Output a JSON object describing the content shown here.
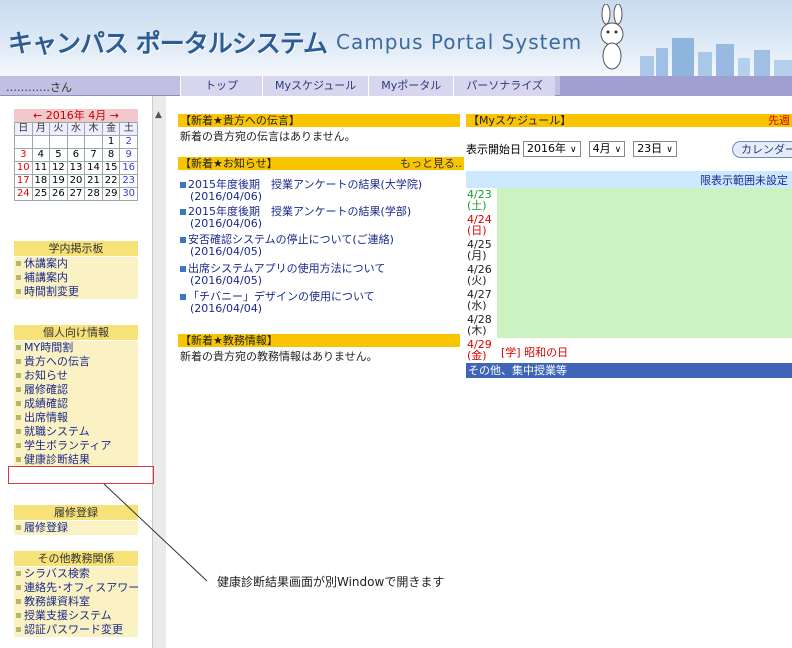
{
  "header": {
    "title_jp": "キャンパス ポータルシステム",
    "title_en": "Campus Portal System"
  },
  "user": {
    "name": "…………さん"
  },
  "nav": {
    "tabs": [
      "トップ",
      "Myスケジュール",
      "Myポータル",
      "パーソナライズ"
    ]
  },
  "calendar": {
    "prev": "←",
    "title": "2016年 4月",
    "next": "→",
    "weekdays": [
      "日",
      "月",
      "火",
      "水",
      "木",
      "金",
      "土"
    ],
    "weeks": [
      [
        "",
        "",
        "",
        "",
        "",
        "1",
        "2"
      ],
      [
        "3",
        "4",
        "5",
        "6",
        "7",
        "8",
        "9"
      ],
      [
        "10",
        "11",
        "12",
        "13",
        "14",
        "15",
        "16"
      ],
      [
        "17",
        "18",
        "19",
        "20",
        "21",
        "22",
        "23"
      ],
      [
        "24",
        "25",
        "26",
        "27",
        "28",
        "29",
        "30"
      ]
    ]
  },
  "sidebar": {
    "board": {
      "heading": "学内掲示板",
      "items": [
        "休講案内",
        "補講案内",
        "時間割変更"
      ]
    },
    "personal": {
      "heading": "個人向け情報",
      "items": [
        "MY時間割",
        "貴方への伝言",
        "お知らせ",
        "履修確認",
        "成績確認",
        "出席情報",
        "就職システム",
        "学生ボランティア",
        "健康診断結果"
      ]
    },
    "registration": {
      "heading": "履修登録",
      "items": [
        "履修登録"
      ]
    },
    "other": {
      "heading": "その他教務関係",
      "items": [
        "シラバス検索",
        "連絡先･オフィスアワー",
        "教務課資料室",
        "授業支援システム",
        "認証パスワード変更"
      ]
    }
  },
  "messages": {
    "heading": "【新着★貴方への伝言】",
    "text": "新着の貴方宛の伝言はありません。"
  },
  "news": {
    "heading": "【新着★お知らせ】",
    "more": "もっと見る..",
    "items": [
      {
        "title": "2015年度後期　授業アンケートの結果(大学院)",
        "date": "(2016/04/06)"
      },
      {
        "title": "2015年度後期　授業アンケートの結果(学部)",
        "date": "(2016/04/06)"
      },
      {
        "title": "安否確認システムの停止について(ご連絡)",
        "date": "(2016/04/05)"
      },
      {
        "title": "出席システムアプリの使用方法について",
        "date": "(2016/04/05)"
      },
      {
        "title": "「チバニー」デザインの使用について",
        "date": "(2016/04/04)"
      }
    ]
  },
  "academic": {
    "heading": "【新着★教務情報】",
    "text": "新着の貴方宛の教務情報はありません。"
  },
  "schedule": {
    "heading": "【Myスケジュール】",
    "heading_right": "先週",
    "start_label": "表示開始日",
    "year": "2016年",
    "month": "4月",
    "day": "23日",
    "calendar_button": "カレンダー",
    "range_label": "限表示範囲未設定",
    "rows": [
      {
        "date": "4/23",
        "dow": "(土)",
        "color": "green",
        "event": ""
      },
      {
        "date": "4/24",
        "dow": "(日)",
        "color": "red",
        "event": ""
      },
      {
        "date": "4/25",
        "dow": "(月)",
        "color": "blk",
        "event": ""
      },
      {
        "date": "4/26",
        "dow": "(火)",
        "color": "blk",
        "event": ""
      },
      {
        "date": "4/27",
        "dow": "(水)",
        "color": "blk",
        "event": ""
      },
      {
        "date": "4/28",
        "dow": "(木)",
        "color": "blk",
        "event": ""
      },
      {
        "date": "4/29",
        "dow": "(金)",
        "color": "red",
        "event": "[学] 昭和の日"
      }
    ],
    "footer": "その他、集中授業等"
  },
  "annotation": {
    "text": "健康診断結果画面が別Windowで開きます"
  },
  "colors": {
    "header_blue": "#2c5d93",
    "menu_heading": "#f7e179",
    "section_heading": "#f9c400",
    "schedule_green": "#ccf2c2",
    "highlight_red": "#d9363e"
  }
}
